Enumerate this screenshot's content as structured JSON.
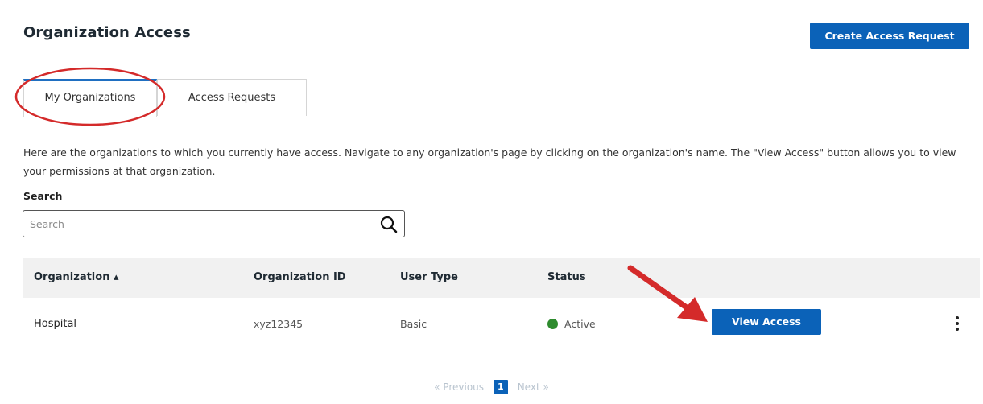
{
  "header": {
    "title": "Organization Access",
    "create_button_label": "Create Access Request"
  },
  "tabs": [
    {
      "label": "My Organizations",
      "active": true
    },
    {
      "label": "Access Requests",
      "active": false
    }
  ],
  "description": "Here are the organizations to which you currently have access. Navigate to any organization's page by clicking on the organization's name. The \"View Access\" button allows you to view your permissions at that organization.",
  "search": {
    "label": "Search",
    "placeholder": "Search",
    "value": ""
  },
  "table": {
    "columns": [
      "Organization ▴",
      "Organization ID",
      "User Type",
      "Status"
    ],
    "rows": [
      {
        "organization": "Hospital",
        "organization_id": "xyz12345",
        "user_type": "Basic",
        "status": "Active",
        "action_label": "View Access"
      }
    ]
  },
  "pagination": {
    "previous_label": "« Previous",
    "current_page": "1",
    "next_label": "Next »"
  },
  "colors": {
    "primary_button": "#0b62b8",
    "active_tab_indicator": "#1f6fc1",
    "status_active": "#2e8b2e",
    "annotation_red": "#d42a2a"
  },
  "icons": {
    "search": "search-icon",
    "more_actions": "kebab-icon",
    "sort": "sort-ascending-icon"
  }
}
